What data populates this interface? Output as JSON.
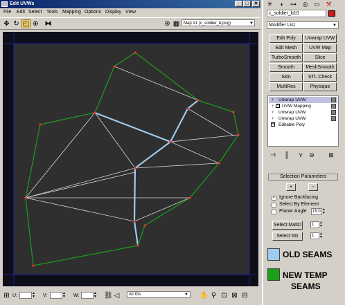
{
  "window": {
    "title": "Edit UVWs",
    "minimize": "_",
    "maximize": "□",
    "close": "✕"
  },
  "menu": [
    "File",
    "Edit",
    "Select",
    "Tools",
    "Mapping",
    "Options",
    "Display",
    "View"
  ],
  "toolbar": {
    "map_select": "Map #1 (c_soldier_b.png)"
  },
  "bottom": {
    "u_label": "U:",
    "v_label": "V:",
    "w_label": "W:",
    "ids_select": "All IDs"
  },
  "command_panel": {
    "object_name": "c_soldier_b10",
    "modifier_list": "Modifier List",
    "modifier_buttons": [
      "Edit Poly",
      "Unwrap UVW",
      "Edit Mesh",
      "UVW Map",
      "TurboSmooth",
      "Slice",
      "Smooth",
      "MeshSmooth",
      "Skin",
      "STL Check",
      "MultiRes",
      "Physique"
    ],
    "stack": [
      {
        "name": "Unwrap UVW",
        "icon": "bulb-icon"
      },
      {
        "name": "UVW Mapping",
        "icon": "bulb-icon"
      },
      {
        "name": "Unwrap UVW",
        "icon": "bulb-icon"
      },
      {
        "name": "Unwrap UVW",
        "icon": "bulb-icon"
      },
      {
        "name": "Editable Poly",
        "icon": "expand-icon"
      }
    ],
    "selection_parameters": {
      "header": "Selection Parameters",
      "plus": "+",
      "minus": "-",
      "ignore_backfacing": "Ignore Backfacing",
      "ignore_backfacing_checked": true,
      "select_by_element": "Select By Element",
      "select_by_element_checked": false,
      "planar_angle": "Planar Angle",
      "planar_angle_checked": false,
      "planar_angle_value": "15.0",
      "select_matid": "Select MatID",
      "matid_value": "1",
      "select_sg": "Select SG",
      "sg_value": "1"
    }
  },
  "legend": {
    "old_seams": "OLD SEAMS",
    "old_color": "#9ecbee",
    "new_seams_line1": "NEW TEMP",
    "new_seams_line2": "SEAMS",
    "new_color": "#1aa01a"
  }
}
